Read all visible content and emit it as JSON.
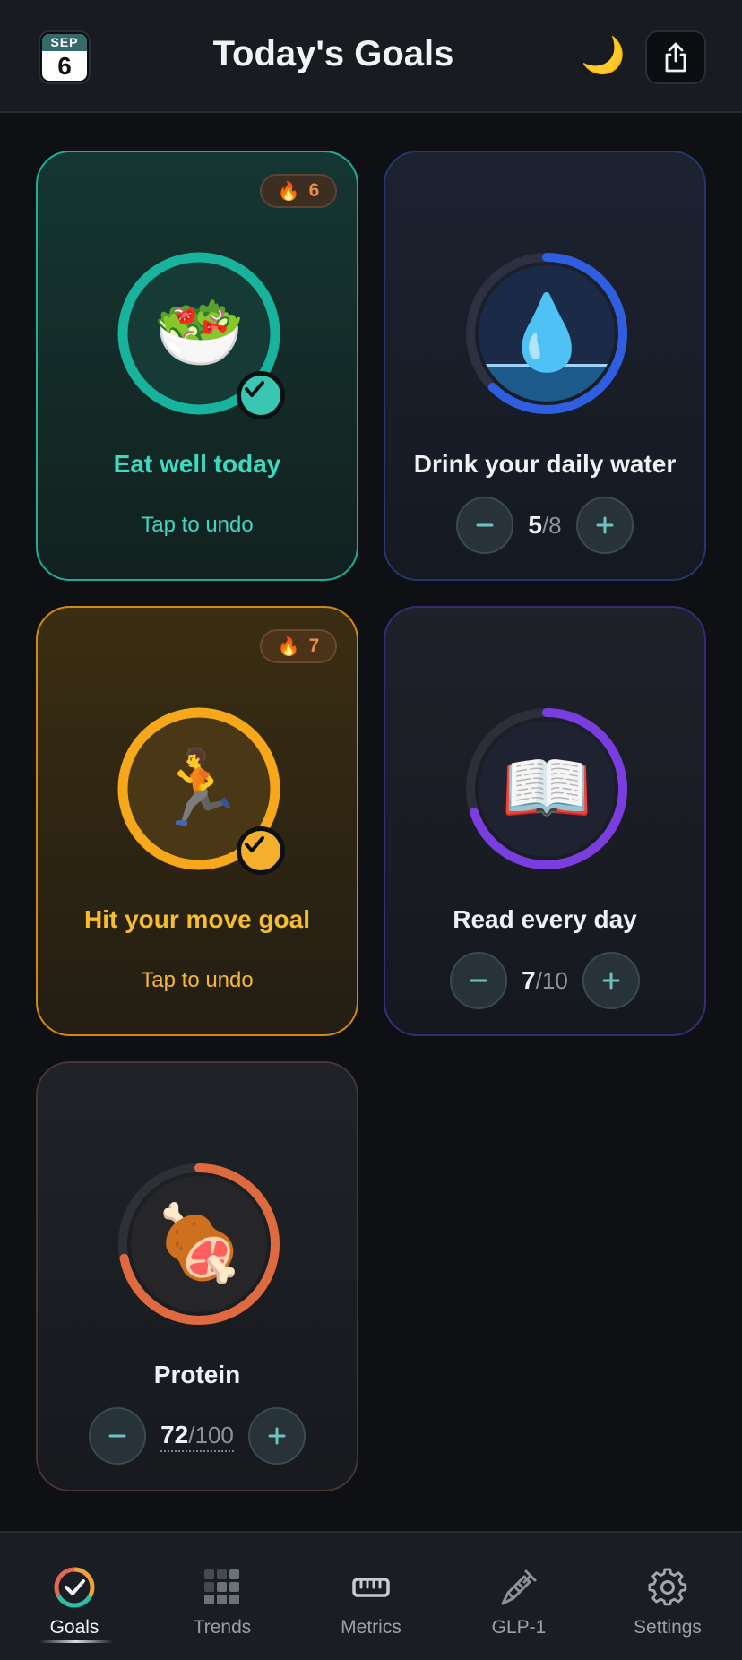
{
  "header": {
    "calendar": {
      "month": "SEP",
      "day": "6"
    },
    "title": "Today's Goals",
    "moon_icon": "crescent-moon-icon",
    "share_icon": "share-icon"
  },
  "cards": [
    {
      "id": "eat",
      "name": "Eat well today",
      "icon": "🥗",
      "streak": "6",
      "completed": true,
      "action": "Tap to undo",
      "accent": "#1fb8a0",
      "progress": 1.0
    },
    {
      "id": "water",
      "name": "Drink your daily water",
      "icon": "💧",
      "current": "5",
      "target": "/8",
      "accent": "#2f5fe0",
      "progress": 0.625
    },
    {
      "id": "move",
      "name": "Hit your move goal",
      "icon": "🏃",
      "streak": "7",
      "completed": true,
      "action": "Tap to undo",
      "accent": "#f6a81a",
      "progress": 1.0
    },
    {
      "id": "read",
      "name": "Read every day",
      "icon": "📖",
      "current": "7",
      "target": "/10",
      "accent": "#7a3ee0",
      "progress": 0.7
    },
    {
      "id": "protein",
      "name": "Protein",
      "icon": "🍖",
      "current": "72",
      "target": "/100",
      "accent": "#e06a40",
      "progress": 0.72
    }
  ],
  "tabs": [
    {
      "label": "Goals",
      "icon": "goals-icon",
      "active": true
    },
    {
      "label": "Trends",
      "icon": "grid-icon",
      "active": false
    },
    {
      "label": "Metrics",
      "icon": "ruler-icon",
      "active": false
    },
    {
      "label": "GLP-1",
      "icon": "syringe-icon",
      "active": false
    },
    {
      "label": "Settings",
      "icon": "gear-icon",
      "active": false
    }
  ],
  "flame_icon": "🔥"
}
